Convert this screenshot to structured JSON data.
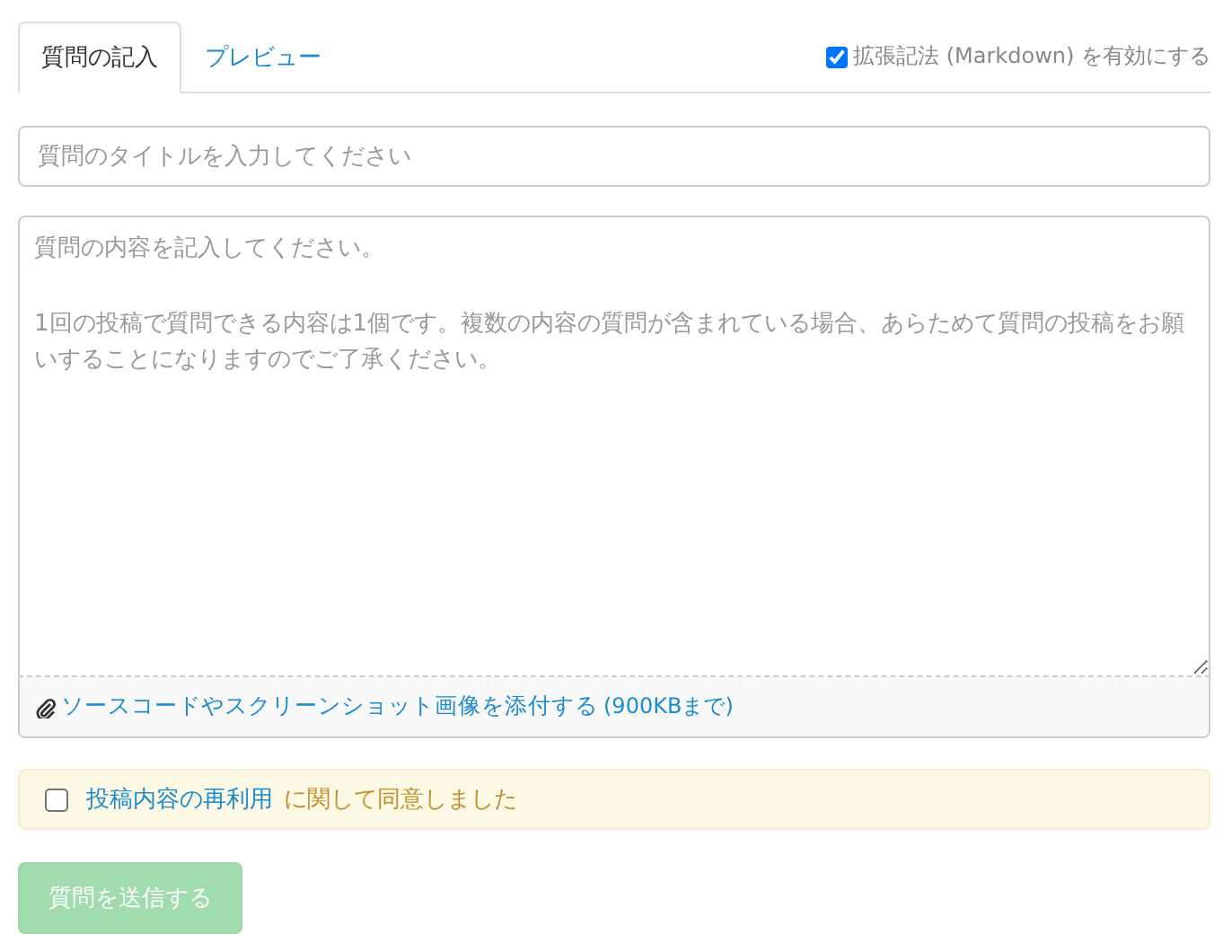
{
  "tabs": [
    {
      "label": "質問の記入",
      "selected": true
    },
    {
      "label": "プレビュー",
      "selected": false
    }
  ],
  "markdown_toggle": {
    "label": "拡張記法 (Markdown) を有効にする",
    "checked": true
  },
  "title_field": {
    "placeholder": "質問のタイトルを入力してください"
  },
  "body_field": {
    "placeholder": "質問の内容を記入してください。\n\n1回の投稿で質問できる内容は1個です。複数の内容の質問が含まれている場合、あらためて質問の投稿をお願いすることになりますのでご了承ください。"
  },
  "attachment": {
    "link": "ソースコードやスクリーンショット画像を添付する",
    "note": "(900KBまで)"
  },
  "agreement": {
    "checked": false,
    "link": "投稿内容の再利用",
    "text": "に関して同意しました"
  },
  "submit": {
    "label": "質問を送信する",
    "disabled": true
  }
}
